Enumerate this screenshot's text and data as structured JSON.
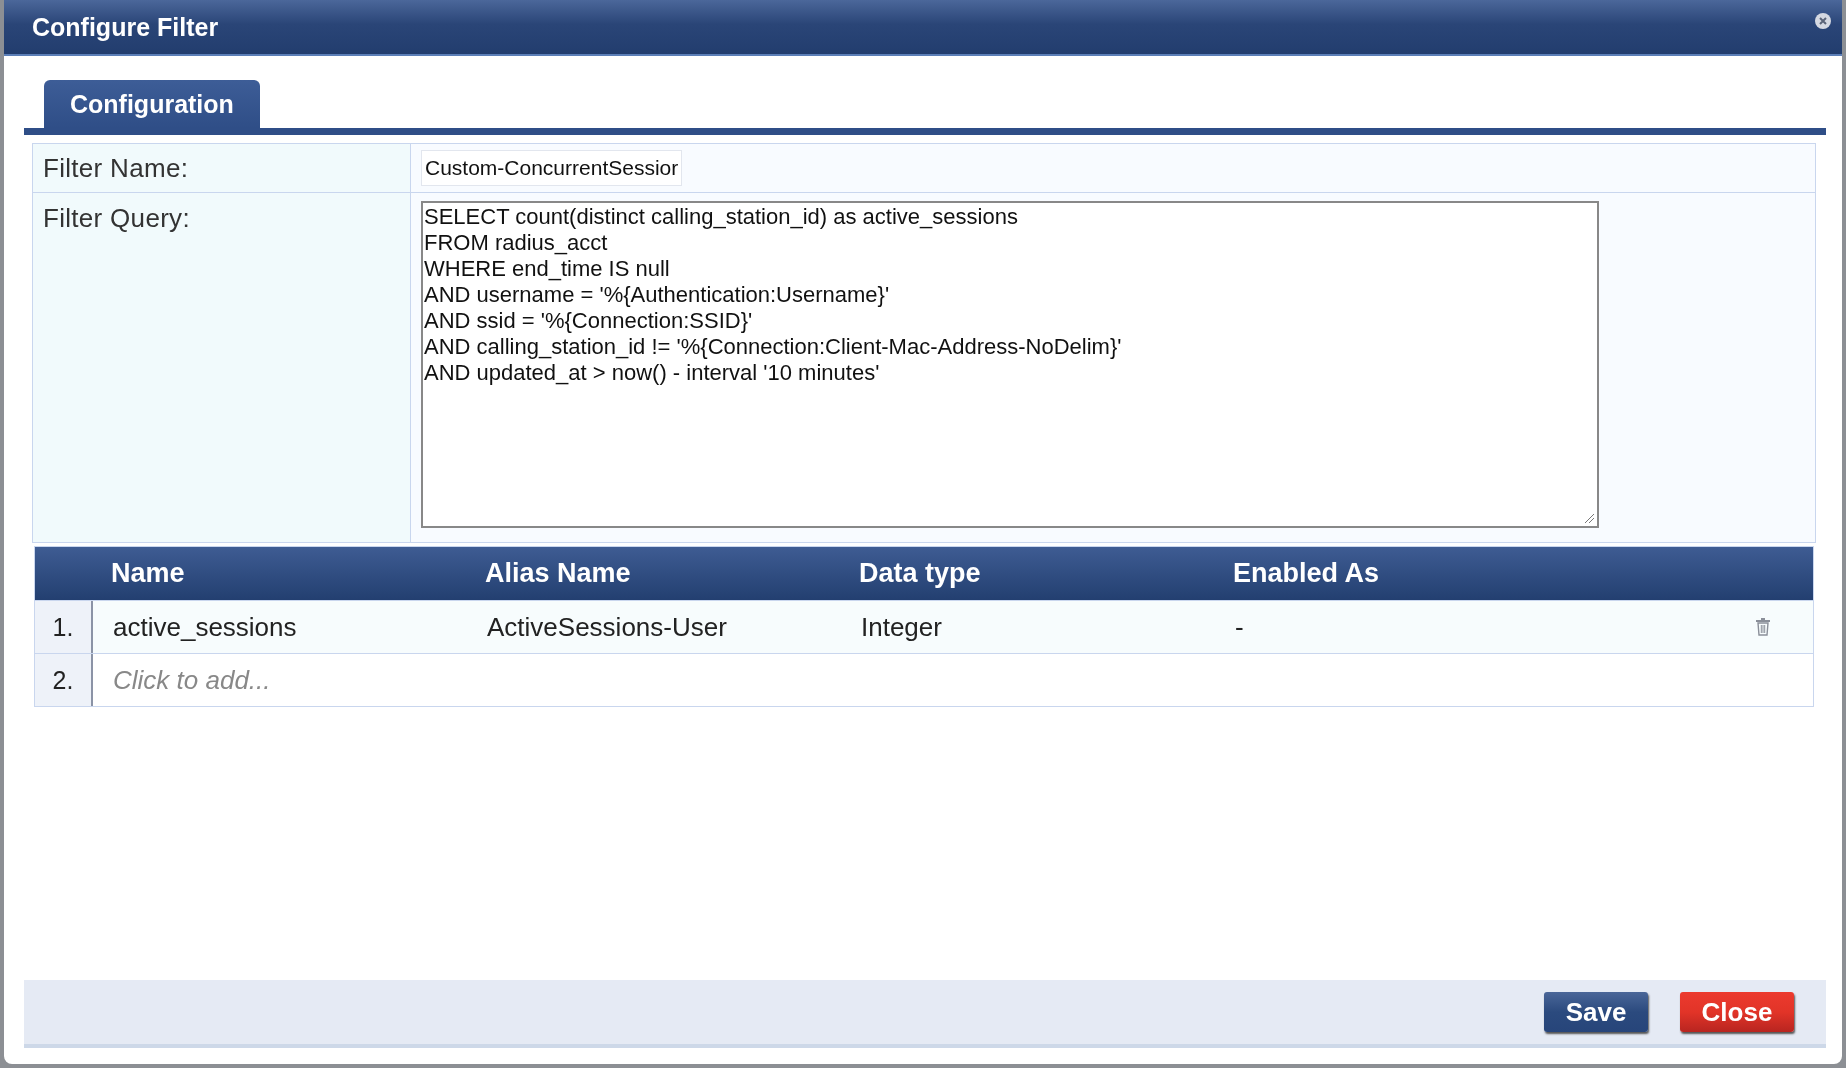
{
  "window": {
    "title": "Configure Filter"
  },
  "tabs": [
    {
      "label": "Configuration",
      "selected": true
    }
  ],
  "form": {
    "fields": [
      {
        "kind": "input",
        "label": "Filter Name:",
        "value": "Custom-ConcurrentSessior"
      },
      {
        "kind": "textarea",
        "label": "Filter Query:",
        "value": "SELECT count(distinct calling_station_id) as active_sessions\nFROM radius_acct\nWHERE end_time IS null\nAND username = '%{Authentication:Username}'\nAND ssid = '%{Connection:SSID}'\nAND calling_station_id != '%{Connection:Client-Mac-Address-NoDelim}'\nAND updated_at > now() - interval '10 minutes'"
      }
    ]
  },
  "table": {
    "columns": [
      "Name",
      "Alias Name",
      "Data type",
      "Enabled As"
    ],
    "rows": [
      {
        "index": "1.",
        "cells": [
          "active_sessions",
          "ActiveSessions-User",
          "Integer",
          "-"
        ]
      }
    ],
    "add_row": {
      "index": "2.",
      "placeholder": "Click to add..."
    }
  },
  "buttons": [
    {
      "kind": "primary",
      "label": "Save"
    },
    {
      "kind": "danger",
      "label": "Close"
    }
  ]
}
